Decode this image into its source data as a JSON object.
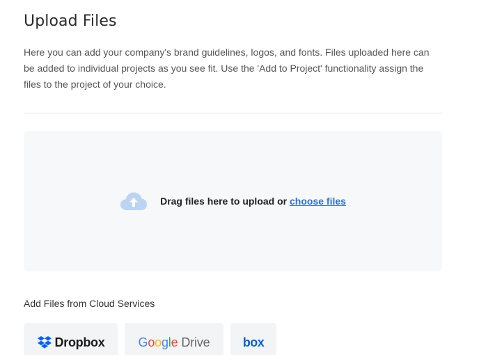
{
  "header": {
    "title": "Upload Files"
  },
  "description": "Here you can add your company's brand guidelines, logos, and fonts. Files uploaded here can be added to individual projects as you see fit. Use the 'Add to Project' functionality assign the files to the project of your choice.",
  "dropzone": {
    "icon": "cloud-upload-icon",
    "prompt": "Drag files here to upload or ",
    "link_label": "choose files",
    "icon_color": "#bcd3f2",
    "link_color": "#2f6fd6",
    "background": "#f7f8fa"
  },
  "cloud_services": {
    "label": "Add Files from Cloud Services",
    "items": [
      {
        "name": "Dropbox",
        "icon": "dropbox-icon",
        "brand_color": "#0061fe"
      },
      {
        "name": "Google Drive",
        "parts": [
          "G",
          "o",
          "o",
          "g",
          "l",
          "e"
        ],
        "suffix": "Drive"
      },
      {
        "name": "box",
        "brand_color": "#0061d5"
      }
    ]
  }
}
